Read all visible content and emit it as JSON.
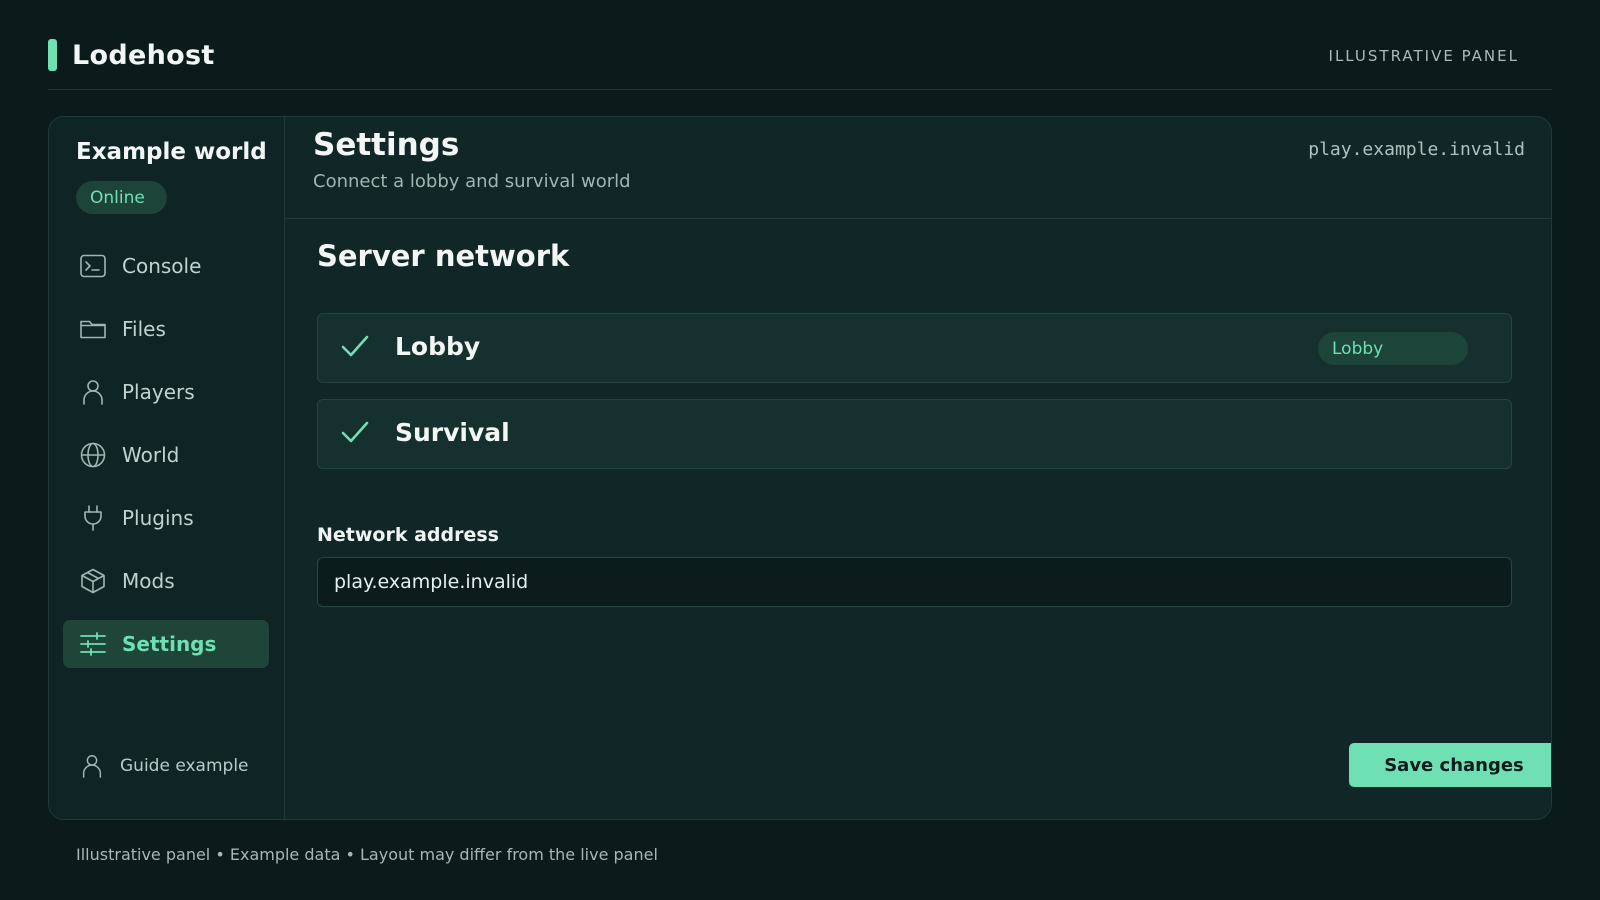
{
  "brand": {
    "name": "Lodehost",
    "accent": "#6ee0b4"
  },
  "top_right_label": "ILLUSTRATIVE PANEL",
  "sidebar": {
    "world_name": "Example world",
    "status": "Online",
    "items": [
      {
        "label": "Console",
        "icon": "terminal-icon",
        "active": false
      },
      {
        "label": "Files",
        "icon": "folder-icon",
        "active": false
      },
      {
        "label": "Players",
        "icon": "user-icon",
        "active": false
      },
      {
        "label": "World",
        "icon": "globe-icon",
        "active": false
      },
      {
        "label": "Plugins",
        "icon": "plug-icon",
        "active": false
      },
      {
        "label": "Mods",
        "icon": "cube-icon",
        "active": false
      },
      {
        "label": "Settings",
        "icon": "sliders-icon",
        "active": true
      }
    ],
    "user": {
      "name": "Guide example",
      "icon": "user-icon"
    }
  },
  "main": {
    "title": "Settings",
    "subtitle": "Connect a lobby and survival world",
    "host": "play.example.invalid",
    "section_title": "Server network",
    "servers": [
      {
        "name": "Lobby",
        "checked": true,
        "tag": "Lobby"
      },
      {
        "name": "Survival",
        "checked": true
      }
    ],
    "field_label": "Network address",
    "field_value": "play.example.invalid",
    "save_label": "Save changes"
  },
  "footer": "Illustrative panel • Example data • Layout may differ from the live panel"
}
